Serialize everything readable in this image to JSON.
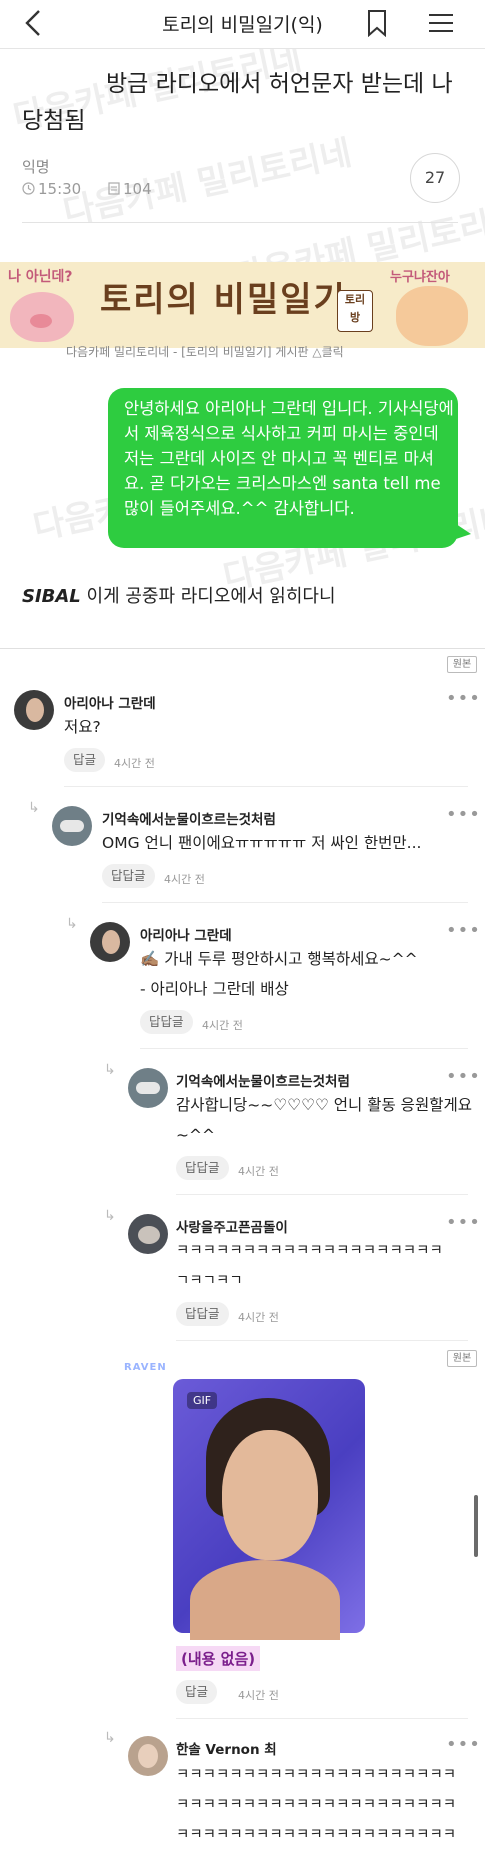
{
  "header": {
    "title": "토리의 비밀일기(익)"
  },
  "watermark": "다음카페 밀리토리네",
  "post": {
    "title": "방금 라디오에서 허언문자 받는데 나 당첨됨",
    "author": "익명",
    "time": "15:30",
    "views": "104",
    "comment_count": "27"
  },
  "banner": {
    "title": "토리의 비밀일기",
    "left_text": "나 아닌데?",
    "right_text": "누구냐잔아",
    "stamp": "토리 방",
    "caption": "다음카페 밀리토리네 - [토리의 비밀일기] 게시판 △클릭"
  },
  "message": {
    "text": "안녕하세요 아리아나 그란데 입니다. 기사식당에서 제육정식으로 식사하고 커피 마시는 중인데 저는 그란데 사이즈 안 마시고 꼭 벤티로 마셔요. 곧 다가오는 크리스마스엔 santa tell me 많이 들어주세요.^^ 감사합니다."
  },
  "caption": {
    "bold": "SIBAL",
    "rest": " 이게 공중파 라디오에서 읽히다니"
  },
  "original_badge": "원본",
  "reply_label": "답글",
  "reply_reply_label": "답답글",
  "comments": [
    {
      "name": "아리아나 그란데",
      "text": "저요?",
      "time": "4시간 전",
      "reply": "답글"
    },
    {
      "name": "기억속에서눈물이흐르는것처럼",
      "text": "OMG 언니 팬이에요ㅠㅠㅠㅠㅠ 저 싸인 한번만...",
      "time": "4시간 전",
      "reply": "답답글"
    },
    {
      "name": "아리아나 그란데",
      "text1": "✍🏽 가내 두루 평안하시고 행복하세요~^^",
      "text2": "- 아리아나 그란데 배상",
      "time": "4시간 전",
      "reply": "답답글"
    },
    {
      "name": "기억속에서눈물이흐르는것처럼",
      "text1": "감사합니당~~♡♡♡♡ 언니 활동 응원할게요",
      "text2": "~^^",
      "time": "4시간 전",
      "reply": "답답글"
    },
    {
      "name": "사랑을주고픈곰돌이",
      "text1": "ㅋㅋㅋㅋㅋㅋㅋㅋㅋㅋㅋㅋㅋㅋㅋㅋㅋㅋㅋㅋ",
      "text2": "ㄱㅋㄱㅋㄱ",
      "time": "4시간 전",
      "reply": "답답글"
    },
    {
      "gif_label": "GIF",
      "sticker": "RAVEN",
      "empty_text": "(내용 없음)",
      "time": "4시간 전",
      "reply": "답글"
    },
    {
      "name": "한솔 Vernon 최",
      "text1": "ㅋㅋㅋㅋㅋㅋㅋㅋㅋㅋㅋㅋㅋㅋㅋㅋㅋㅋㅋㅋㅋ",
      "text2": "ㅋㅋㅋㅋㅋㅋㅋㅋㅋㅋㅋㅋㅋㅋㅋㅋㅋㅋㅋㅋㅋ",
      "text3": "ㅋㅋㅋㅋㅋㅋㅋㅋㅋㅋㅋㅋㅋㅋㅋㅋㅋㅋㅋㅋㅋ"
    }
  ],
  "icons": {
    "back": "back-icon",
    "bookmark": "bookmark-icon",
    "menu": "menu-icon",
    "clock": "clock-icon",
    "views": "views-icon",
    "more": "more-icon",
    "reply_arrow": "reply-arrow-icon"
  }
}
